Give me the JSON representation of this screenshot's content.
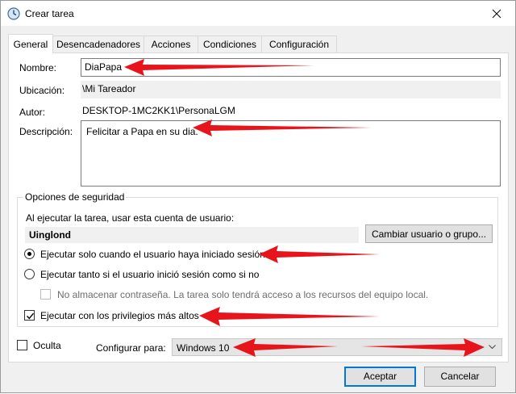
{
  "window": {
    "title": "Crear tarea"
  },
  "tabs": [
    {
      "label": "General"
    },
    {
      "label": "Desencadenadores"
    },
    {
      "label": "Acciones"
    },
    {
      "label": "Condiciones"
    },
    {
      "label": "Configuración"
    }
  ],
  "general": {
    "name_label": "Nombre:",
    "name_value": "DiaPapa",
    "location_label": "Ubicación:",
    "location_value": "\\Mi Tareador",
    "author_label": "Autor:",
    "author_value": "DESKTOP-1MC2KK1\\PersonaLGM",
    "description_label": "Descripción:",
    "description_value": "Felicitar a Papa en su dia."
  },
  "security": {
    "group_title": "Opciones de seguridad",
    "account_prompt": "Al ejecutar la tarea, usar esta cuenta de usuario:",
    "user_value": "Uinglond",
    "change_user_button": "Cambiar usuario o grupo...",
    "radio_logged_on": "Ejecutar solo cuando el usuario haya iniciado sesión",
    "radio_whether": "Ejecutar tanto si el usuario inició sesión como si no",
    "no_store_password": "No almacenar contraseña. La tarea solo tendrá acceso a los recursos del equipo local.",
    "highest_privileges": "Ejecutar con los privilegios más altos",
    "selected_radio": "logged_on",
    "highest_privileges_checked": true,
    "no_store_password_checked": false
  },
  "bottom": {
    "hidden_label": "Oculta",
    "hidden_checked": false,
    "configure_label": "Configurar para:",
    "configure_value": "Windows 10"
  },
  "buttons": {
    "accept": "Aceptar",
    "cancel": "Cancelar"
  },
  "colors": {
    "annotation_arrow": "#e8141b",
    "accent": "#0078d7"
  }
}
